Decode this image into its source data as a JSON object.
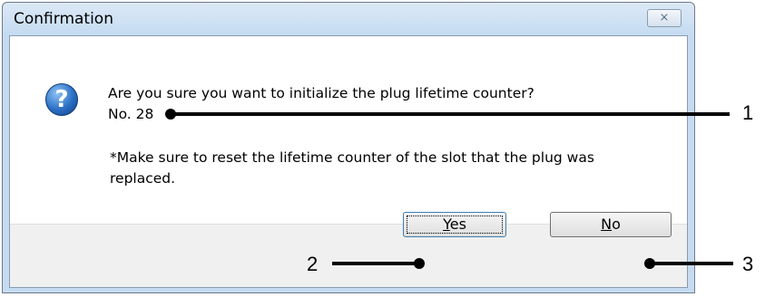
{
  "dialog": {
    "title": "Confirmation",
    "close_glyph": "⨯",
    "icon": "question-icon",
    "icon_glyph": "?",
    "message_line1": "Are you sure you want to initialize the plug lifetime counter?",
    "message_line2": "No. 28",
    "note_line1": "*Make sure to reset the lifetime counter of the slot that the plug was",
    "note_line2": "replaced.",
    "yes_label_hotkey": "Y",
    "yes_label_rest": "es",
    "no_label_hotkey": "N",
    "no_label_rest": "o"
  },
  "callouts": {
    "c1": "1",
    "c2": "2",
    "c3": "3"
  }
}
